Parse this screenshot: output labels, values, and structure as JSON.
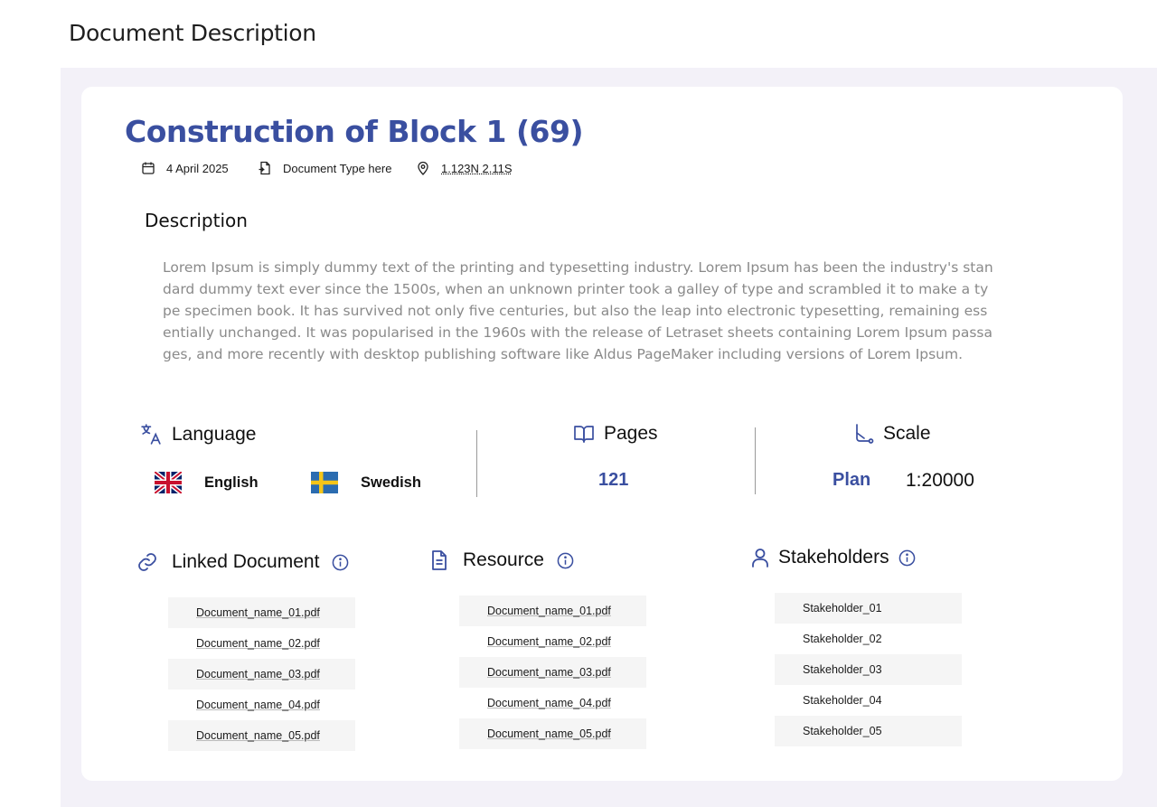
{
  "page_title": "Document Description",
  "document": {
    "title": "Construction of Block 1 (69)",
    "date": "4 April 2025",
    "type": "Document Type here",
    "coordinates": "1.123N 2.11S"
  },
  "description": {
    "heading": "Description",
    "text": "Lorem Ipsum is simply dummy text of the printing and typesetting industry. Lorem Ipsum has been the industry's standard dummy text ever since the 1500s, when an unknown printer took a galley of type and scrambled it to make a type specimen book. It has survived not only five centuries, but also the leap into electronic typesetting, remaining essentially unchanged. It was popularised in the 1960s with the release of Letraset sheets containing Lorem Ipsum passages, and more recently with desktop publishing software like Aldus PageMaker including versions of Lorem Ipsum."
  },
  "language": {
    "heading": "Language",
    "items": [
      {
        "label": "English",
        "flag": "uk-flag"
      },
      {
        "label": "Swedish",
        "flag": "sweden-flag"
      }
    ]
  },
  "pages": {
    "heading": "Pages",
    "value": "121"
  },
  "scale": {
    "heading": "Scale",
    "type": "Plan",
    "value": "1:20000"
  },
  "linked_documents": {
    "heading": "Linked Document",
    "items": [
      "Document_name_01.pdf",
      "Document_name_02.pdf",
      "Document_name_03.pdf",
      "Document_name_04.pdf",
      "Document_name_05.pdf"
    ]
  },
  "resources": {
    "heading": "Resource",
    "items": [
      "Document_name_01.pdf",
      "Document_name_02.pdf",
      "Document_name_03.pdf",
      "Document_name_04.pdf",
      "Document_name_05.pdf"
    ]
  },
  "stakeholders": {
    "heading": "Stakeholders",
    "items": [
      "Stakeholder_01",
      "Stakeholder_02",
      "Stakeholder_03",
      "Stakeholder_04",
      "Stakeholder_05"
    ]
  },
  "colors": {
    "accent": "#3a4fa0",
    "panel_bg": "#f3f1f8",
    "row_bg": "#f5f5f5"
  }
}
